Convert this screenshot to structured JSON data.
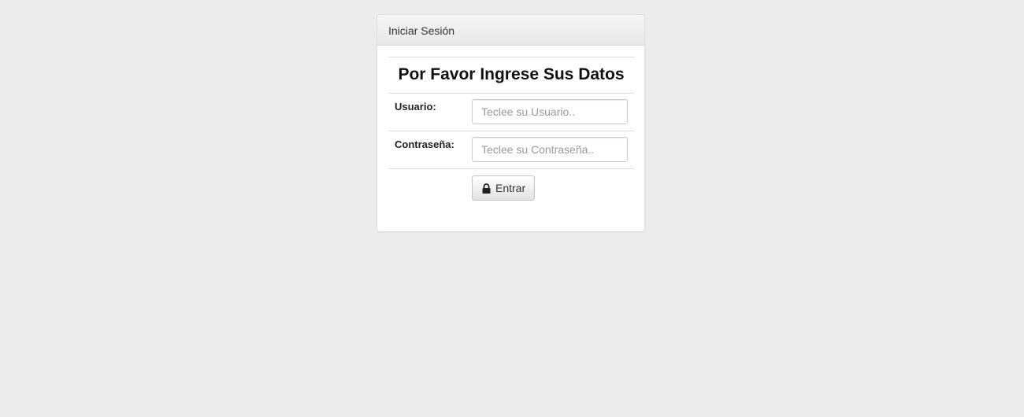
{
  "panel": {
    "heading": "Iniciar Sesión"
  },
  "form": {
    "title": "Por Favor Ingrese Sus Datos",
    "user_label": "Usuario:",
    "user_value": "",
    "user_placeholder": "Teclee su Usuario..",
    "password_label": "Contraseña:",
    "password_value": "",
    "password_placeholder": "Teclee su Contraseña..",
    "submit_label": "Entrar",
    "submit_icon": "lock-icon"
  }
}
